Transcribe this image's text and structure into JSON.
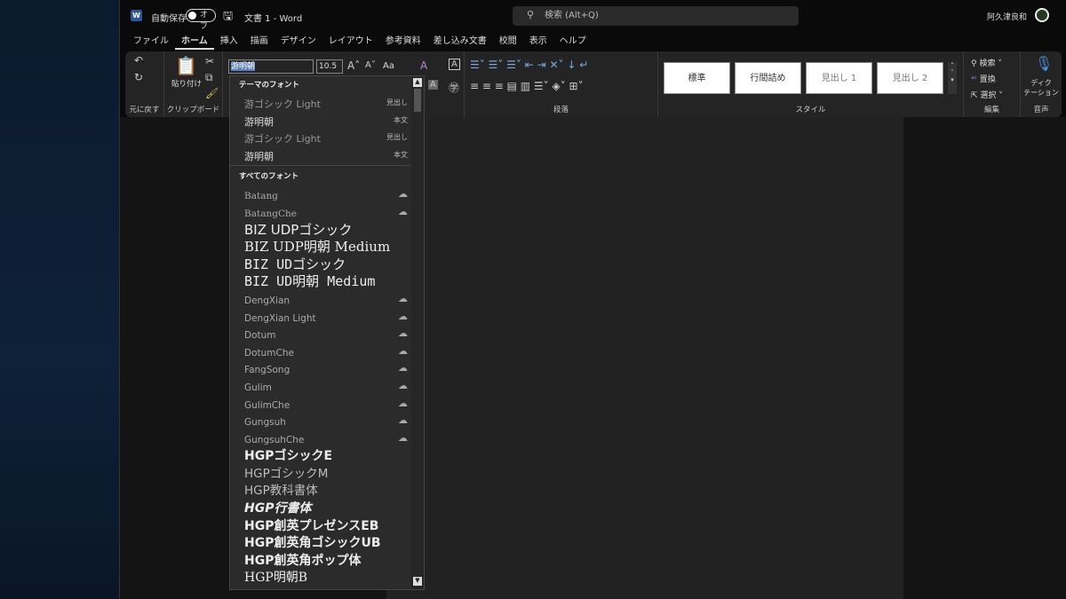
{
  "title": {
    "autosave": "自動保存",
    "toggle": "オフ",
    "doc": "文書 1  -  Word",
    "search": "検索 (Alt+Q)",
    "user": "阿久津良和"
  },
  "tabs": [
    "ファイル",
    "ホーム",
    "挿入",
    "描画",
    "デザイン",
    "レイアウト",
    "参考資料",
    "差し込み文書",
    "校閲",
    "表示",
    "ヘルプ"
  ],
  "ribbon": {
    "undo_group": "元に戻す",
    "clipboard_group": "クリップボード",
    "paste": "貼り付け",
    "font_name": "游明朝",
    "font_size": "10.5",
    "aa": "Aa",
    "paragraph_group": "段落",
    "styles_group": "スタイル",
    "styles": [
      "標準",
      "行間詰め",
      "見出し 1",
      "見出し 2"
    ],
    "find": "検索",
    "replace": "置換",
    "select": "選択",
    "editing_group": "編集",
    "dictate": "ディク\nテーション",
    "voice_group": "音声"
  },
  "dropdown": {
    "theme_header": "テーマのフォント",
    "theme": [
      {
        "name": "游ゴシック Light",
        "tag": "見出し"
      },
      {
        "name": "游明朝",
        "tag": "本文"
      },
      {
        "name": "游ゴシック Light",
        "tag": "見出し"
      },
      {
        "name": "游明朝",
        "tag": "本文"
      }
    ],
    "all_header": "すべてのフォント",
    "fonts": [
      {
        "name": "Batang",
        "cloud": true
      },
      {
        "name": "BatangChe",
        "cloud": true
      },
      {
        "name": "BIZ UDPゴシック"
      },
      {
        "name": "BIZ UDP明朝 Medium"
      },
      {
        "name": "BIZ UDゴシック"
      },
      {
        "name": "BIZ UD明朝 Medium"
      },
      {
        "name": "DengXian",
        "cloud": true
      },
      {
        "name": "DengXian Light",
        "cloud": true
      },
      {
        "name": "Dotum",
        "cloud": true
      },
      {
        "name": "DotumChe",
        "cloud": true
      },
      {
        "name": "FangSong",
        "cloud": true
      },
      {
        "name": "Gulim",
        "cloud": true
      },
      {
        "name": "GulimChe",
        "cloud": true
      },
      {
        "name": "Gungsuh",
        "cloud": true
      },
      {
        "name": "GungsuhChe",
        "cloud": true
      },
      {
        "name": "HGPゴシックE"
      },
      {
        "name": "HGPゴシックM"
      },
      {
        "name": "HGP教科書体"
      },
      {
        "name": "HGP行書体"
      },
      {
        "name": "HGP創英プレゼンスEB"
      },
      {
        "name": "HGP創英角ゴシックUB"
      },
      {
        "name": "HGP創英角ポップ体"
      },
      {
        "name": "HGP明朝B"
      }
    ]
  },
  "icons": {
    "cloud": "cloud-download-icon"
  }
}
